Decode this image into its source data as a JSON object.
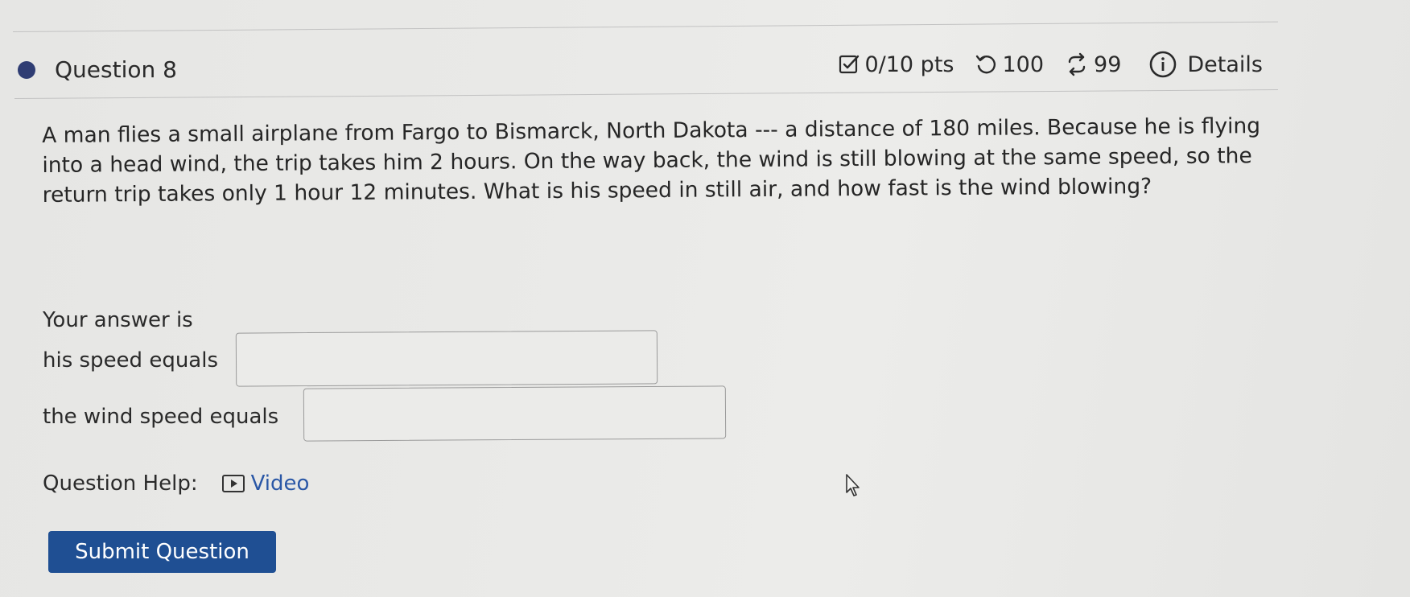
{
  "header": {
    "question_title": "Question 8",
    "score": "0/10 pts",
    "retries": "100",
    "attempts": "99",
    "details_label": "Details",
    "icons": [
      "check-square-icon",
      "undo-icon",
      "repeat-icon",
      "info-icon"
    ]
  },
  "question": {
    "text": "A man flies a small airplane from Fargo to Bismarck, North Dakota --- a distance of 180 miles. Because he is flying into a head wind, the trip takes him 2 hours. On the way back, the wind is still blowing at the same speed, so the return trip takes only 1 hour 12 minutes. What is his speed in still air, and how fast is the wind blowing?"
  },
  "answer": {
    "intro": "Your answer is",
    "speed_label": "his speed equals",
    "speed_value": "",
    "wind_label": "the wind speed equals",
    "wind_value": ""
  },
  "help": {
    "label": "Question Help:",
    "video_label": "Video"
  },
  "submit_label": "Submit Question",
  "colors": {
    "accent_dark": "#2f3d73",
    "submit_bg": "#1f4f93",
    "link": "#2a57a6"
  }
}
